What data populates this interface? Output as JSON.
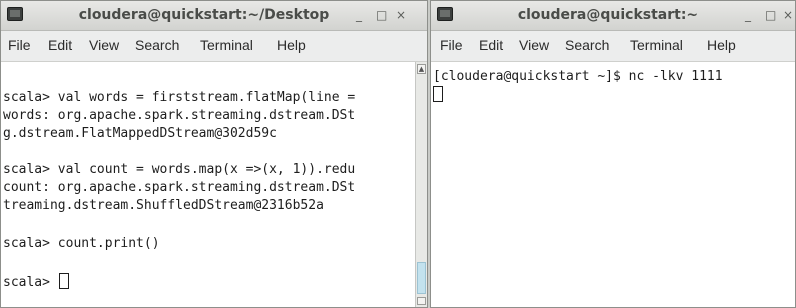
{
  "left_window": {
    "title": "cloudera@quickstart:~/Desktop",
    "minimize": "_",
    "maximize": "□",
    "close": "×",
    "menu": [
      "File",
      "Edit",
      "View",
      "Search",
      "Terminal",
      "Help"
    ],
    "lines": [
      "scala> val words = firststream.flatMap(line =",
      "words: org.apache.spark.streaming.dstream.DSt",
      "g.dstream.FlatMappedDStream@302d59c",
      "",
      "scala> val count = words.map(x =>(x, 1)).redu",
      "count: org.apache.spark.streaming.dstream.DSt",
      "treaming.dstream.ShuffledDStream@2316b52a",
      "",
      "scala> count.print()",
      "",
      "scala> "
    ]
  },
  "right_window": {
    "title": "cloudera@quickstart:~",
    "minimize": "_",
    "maximize": "□",
    "close": "×",
    "menu": [
      "File",
      "Edit",
      "View",
      "Search",
      "Terminal",
      "Help"
    ],
    "lines": [
      "[cloudera@quickstart ~]$ nc -lkv 1111"
    ]
  },
  "scroll_up_icon": "▲"
}
